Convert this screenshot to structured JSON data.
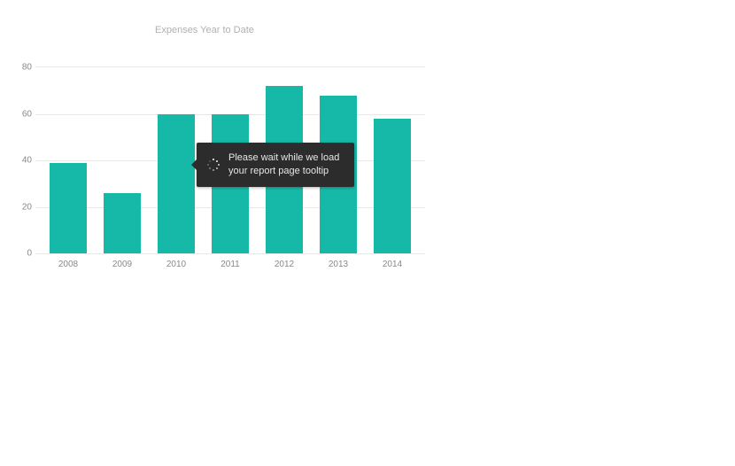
{
  "chart_data": {
    "type": "bar",
    "title": "Expenses Year to Date",
    "categories": [
      "2008",
      "2009",
      "2010",
      "2011",
      "2012",
      "2013",
      "2014"
    ],
    "values": [
      39,
      26,
      60,
      60,
      72,
      68,
      58
    ],
    "ylabel": "",
    "xlabel": "",
    "ylim": [
      0,
      80
    ],
    "yticks": [
      0,
      20,
      40,
      60,
      80
    ],
    "color": "#16b8a7"
  },
  "tooltip": {
    "text": "Please wait while we load your report page tooltip"
  }
}
